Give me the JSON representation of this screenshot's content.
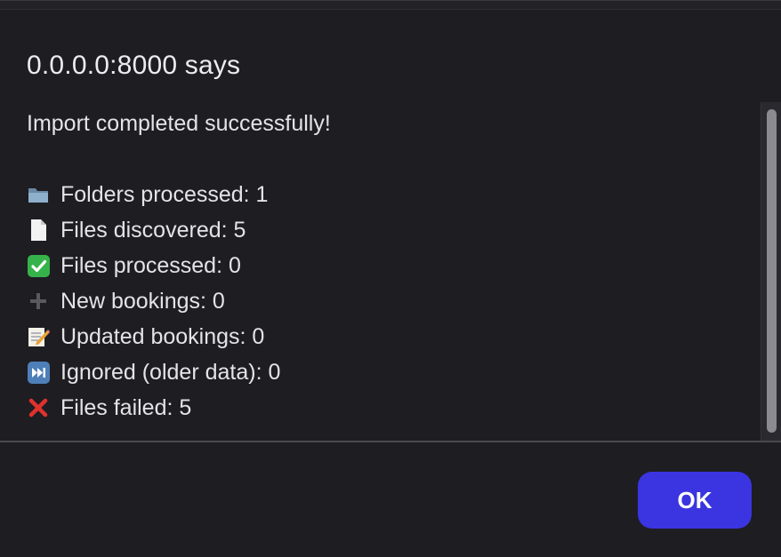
{
  "dialog": {
    "title": "0.0.0.0:8000 says",
    "headline": "Import completed successfully!",
    "stats": [
      {
        "icon": "folder-icon",
        "text": "Folders processed: 1"
      },
      {
        "icon": "document-icon",
        "text": "Files discovered: 5"
      },
      {
        "icon": "check-mark-icon",
        "text": "Files processed: 0"
      },
      {
        "icon": "plus-icon",
        "text": "New bookings: 0"
      },
      {
        "icon": "memo-icon",
        "text": "Updated bookings: 0"
      },
      {
        "icon": "skip-forward-icon",
        "text": "Ignored (older data): 0"
      },
      {
        "icon": "cross-mark-icon",
        "text": "Files failed: 5"
      }
    ],
    "ok_label": "OK"
  },
  "colors": {
    "background": "#1e1d22",
    "button": "#3a35e0",
    "check": "#35b34a",
    "cross": "#e0322d"
  }
}
